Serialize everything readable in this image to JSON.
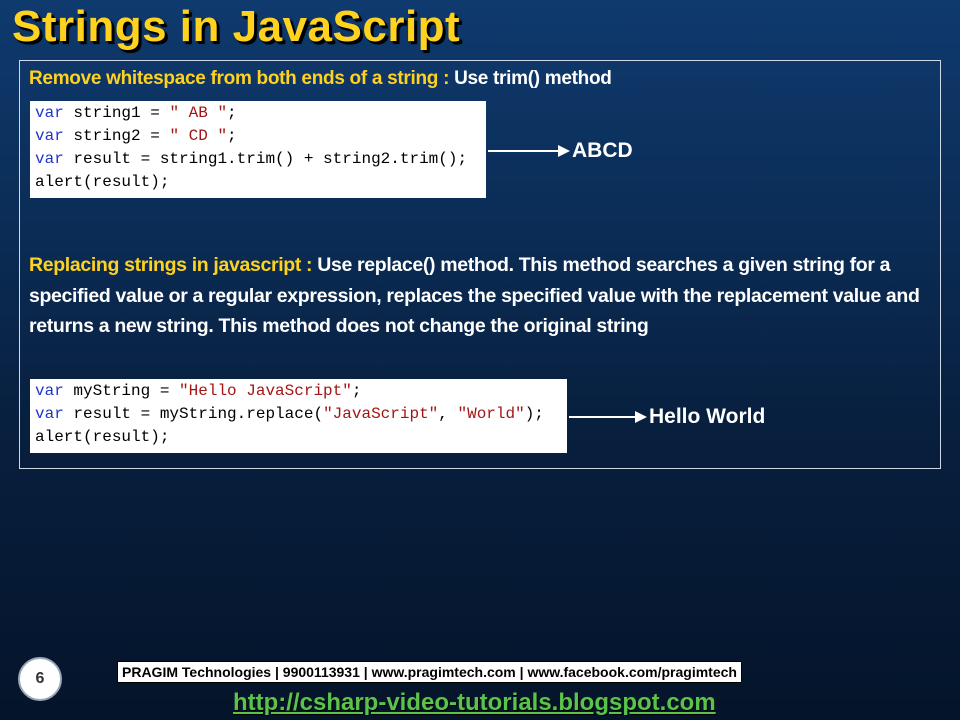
{
  "title": "Strings in JavaScript",
  "section1": {
    "label": "Remove whitespace from both ends of a string :",
    "text": " Use trim() method",
    "code": [
      [
        {
          "t": "var",
          "c": "kw"
        },
        {
          "t": " string1 = "
        },
        {
          "t": "\" AB \"",
          "c": "str"
        },
        {
          "t": ";"
        }
      ],
      [
        {
          "t": "var",
          "c": "kw"
        },
        {
          "t": " string2 = "
        },
        {
          "t": "\" CD \"",
          "c": "str"
        },
        {
          "t": ";"
        }
      ],
      [
        {
          "t": "var",
          "c": "kw"
        },
        {
          "t": " result = string1.trim() + string2.trim();"
        }
      ],
      [
        {
          "t": "alert(result);"
        }
      ]
    ],
    "result": "ABCD"
  },
  "section2": {
    "label": "Replacing strings in javascript :",
    "text": " Use replace() method. This method searches a given string for a specified value or a regular expression, replaces the specified value with the replacement value and returns a new string. This method does not change the original string",
    "code": [
      [
        {
          "t": "var",
          "c": "kw"
        },
        {
          "t": " myString = "
        },
        {
          "t": "\"Hello JavaScript\"",
          "c": "str"
        },
        {
          "t": ";"
        }
      ],
      [
        {
          "t": "var",
          "c": "kw"
        },
        {
          "t": " result = myString.replace("
        },
        {
          "t": "\"JavaScript\"",
          "c": "str"
        },
        {
          "t": ", "
        },
        {
          "t": "\"World\"",
          "c": "str"
        },
        {
          "t": ");"
        }
      ],
      [
        {
          "t": "alert(result);"
        }
      ]
    ],
    "result": "Hello World"
  },
  "footer": {
    "page_number": "6",
    "company": "PRAGIM Technologies | 9900113931 | www.pragimtech.com | www.facebook.com/pragimtech",
    "link": "http://csharp-video-tutorials.blogspot.com"
  }
}
